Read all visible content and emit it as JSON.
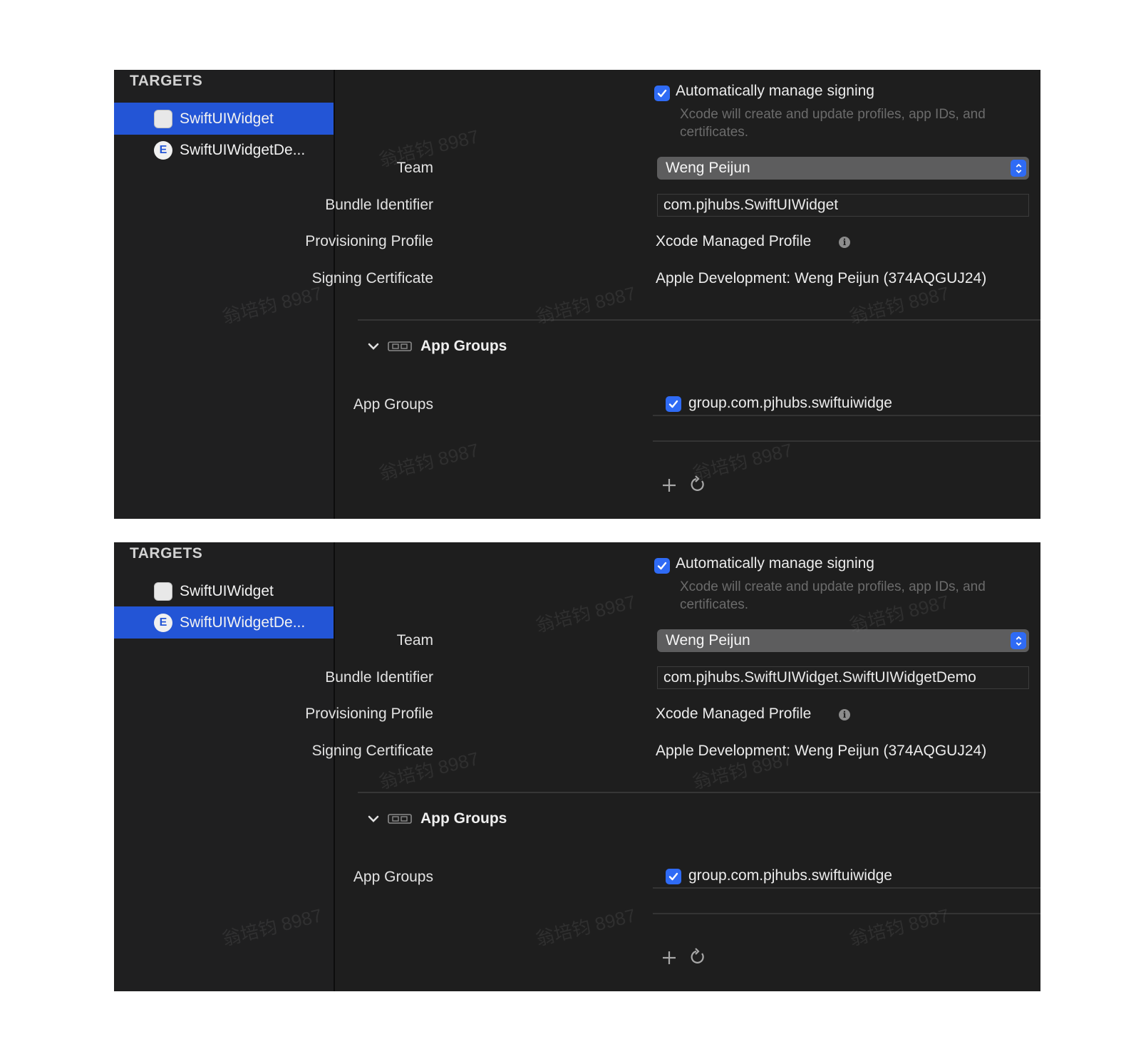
{
  "panels": [
    {
      "sidebar": {
        "header": "TARGETS",
        "items": [
          {
            "label": "SwiftUIWidget",
            "icon": "app-icon",
            "selected": true
          },
          {
            "label": "SwiftUIWidgetDe...",
            "icon": "extension-icon",
            "selected": false
          }
        ]
      },
      "signing": {
        "auto_label": "Automatically manage signing",
        "auto_checked": true,
        "auto_desc": "Xcode will create and update profiles, app IDs, and certificates.",
        "team_label": "Team",
        "team_value": "Weng Peijun",
        "bundle_label": "Bundle Identifier",
        "bundle_value": "com.pjhubs.SwiftUIWidget",
        "profile_label": "Provisioning Profile",
        "profile_value": "Xcode Managed Profile",
        "cert_label": "Signing Certificate",
        "cert_value": "Apple Development: Weng Peijun (374AQGUJ24)"
      },
      "app_groups": {
        "section_title": "App Groups",
        "field_label": "App Groups",
        "group_value": "group.com.pjhubs.swiftuiwidge",
        "group_checked": true
      }
    },
    {
      "sidebar": {
        "header": "TARGETS",
        "items": [
          {
            "label": "SwiftUIWidget",
            "icon": "app-icon",
            "selected": false
          },
          {
            "label": "SwiftUIWidgetDe...",
            "icon": "extension-icon",
            "selected": true
          }
        ]
      },
      "signing": {
        "auto_label": "Automatically manage signing",
        "auto_checked": true,
        "auto_desc": "Xcode will create and update profiles, app IDs, and certificates.",
        "team_label": "Team",
        "team_value": "Weng Peijun",
        "bundle_label": "Bundle Identifier",
        "bundle_value": "com.pjhubs.SwiftUIWidget.SwiftUIWidgetDemo",
        "profile_label": "Provisioning Profile",
        "profile_value": "Xcode Managed Profile",
        "cert_label": "Signing Certificate",
        "cert_value": "Apple Development: Weng Peijun (374AQGUJ24)"
      },
      "app_groups": {
        "section_title": "App Groups",
        "field_label": "App Groups",
        "group_value": "group.com.pjhubs.swiftuiwidge",
        "group_checked": true
      }
    }
  ],
  "watermark_text": "翁培钧 8987",
  "colors": {
    "accent": "#2f6bf5",
    "selection": "#2355d6",
    "panel_bg": "#1e1e1e"
  }
}
